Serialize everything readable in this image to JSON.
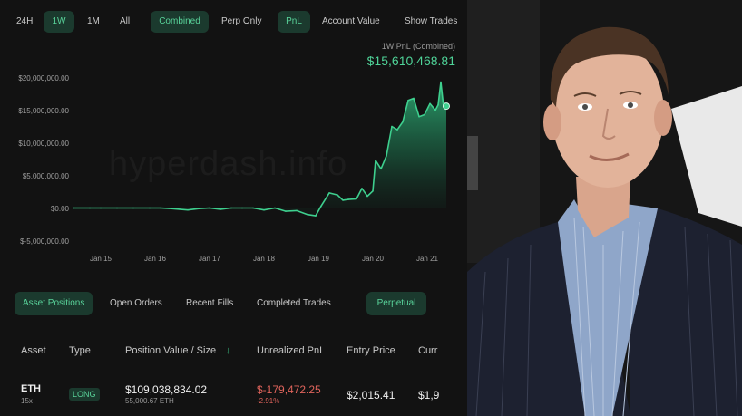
{
  "toolbar": {
    "range_tabs": [
      "24H",
      "1W",
      "1M",
      "All"
    ],
    "active_range": "1W",
    "mode_tabs": [
      "Combined",
      "Perp Only"
    ],
    "active_mode": "Combined",
    "metric_tabs": [
      "PnL",
      "Account Value"
    ],
    "active_metric": "PnL",
    "show_trades_label": "Show Trades"
  },
  "pnl_header": {
    "caption": "1W PnL (Combined)",
    "value": "$15,610,468.81"
  },
  "watermark": "hyperdash.info",
  "chart_data": {
    "type": "area",
    "title": "",
    "xlabel": "",
    "ylabel": "",
    "y_ticks": [
      "$20,000,000.00",
      "$15,000,000.00",
      "$10,000,000.00",
      "$5,000,000.00",
      "$0.00",
      "$-5,000,000.00"
    ],
    "x_ticks": [
      "Jan 15",
      "Jan 16",
      "Jan 17",
      "Jan 18",
      "Jan 19",
      "Jan 20",
      "Jan 21"
    ],
    "ylim": [
      -5000000,
      20000000
    ],
    "xlim": [
      14.5,
      21.4
    ],
    "grid": false,
    "color": "#3ecf8e",
    "x": [
      14.5,
      14.8,
      15.0,
      15.3,
      15.6,
      15.9,
      16.1,
      16.3,
      16.45,
      16.6,
      16.8,
      17.0,
      17.2,
      17.4,
      17.6,
      17.8,
      18.0,
      18.2,
      18.4,
      18.6,
      18.8,
      18.95,
      19.05,
      19.2,
      19.35,
      19.45,
      19.55,
      19.7,
      19.8,
      19.9,
      20.0,
      20.05,
      20.15,
      20.25,
      20.35,
      20.45,
      20.55,
      20.65,
      20.75,
      20.85,
      20.95,
      21.05,
      21.15,
      21.2,
      21.25,
      21.3,
      21.35
    ],
    "y": [
      0,
      0,
      0,
      0,
      0,
      0,
      0,
      -100000,
      -200000,
      -300000,
      -100000,
      0,
      -200000,
      0,
      0,
      0,
      -300000,
      0,
      -500000,
      -400000,
      -1000000,
      -1200000,
      300000,
      2300000,
      2000000,
      1200000,
      1300000,
      1400000,
      3000000,
      1800000,
      2600000,
      7300000,
      6000000,
      8000000,
      12500000,
      12000000,
      13200000,
      16500000,
      16800000,
      14000000,
      14300000,
      16000000,
      15000000,
      15800000,
      19300000,
      15500000,
      15610468
    ]
  },
  "positions_tabs": {
    "items": [
      "Asset Positions",
      "Open Orders",
      "Recent Fills",
      "Completed Trades"
    ],
    "active": "Asset Positions",
    "filter": "Perpetual"
  },
  "table": {
    "headers": [
      "Asset",
      "Type",
      "Position Value / Size",
      "Unrealized PnL",
      "Entry Price",
      "Curr"
    ],
    "sort_arrow": "↓",
    "row": {
      "asset": "ETH",
      "leverage": "15x",
      "type": "LONG",
      "position_value": "$109,038,834.02",
      "size": "55,000.67 ETH",
      "unrealized_pnl": "$-179,472.25",
      "unrealized_pct": "-2.91%",
      "entry_price": "$2,015.41",
      "current_price": "$1,9"
    }
  },
  "colors": {
    "accent": "#3ecf8e",
    "accent_bg": "#1b3a2e",
    "negative": "#e0645c",
    "background": "#121212"
  }
}
